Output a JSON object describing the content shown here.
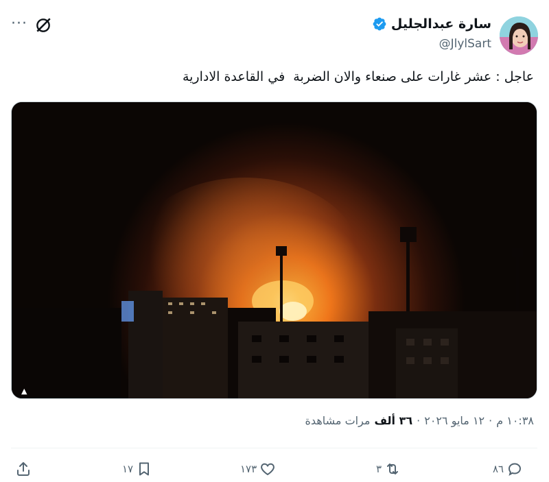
{
  "author": {
    "name": "سارة عبدالجليل",
    "handle": "@JlylSart",
    "verified": true
  },
  "header_icons": [
    "more-icon",
    "grok-icon"
  ],
  "tweet": {
    "text": "عاجل : عشر غارات على صنعاء والان الضربة  في القاعدة الادارية"
  },
  "meta": {
    "time": "١٠:٣٨ م",
    "date": "١٢ مايو ٢٠٢٦",
    "views_count": "٣٦ ألف",
    "views_label": "مرات مشاهدة"
  },
  "actions": {
    "replies": "٨٦",
    "retweets": "٣",
    "likes": "١٧٣",
    "bookmarks": "١٧"
  },
  "colors": {
    "text": "#0f1419",
    "muted": "#536471",
    "verified": "#1d9bf0"
  }
}
